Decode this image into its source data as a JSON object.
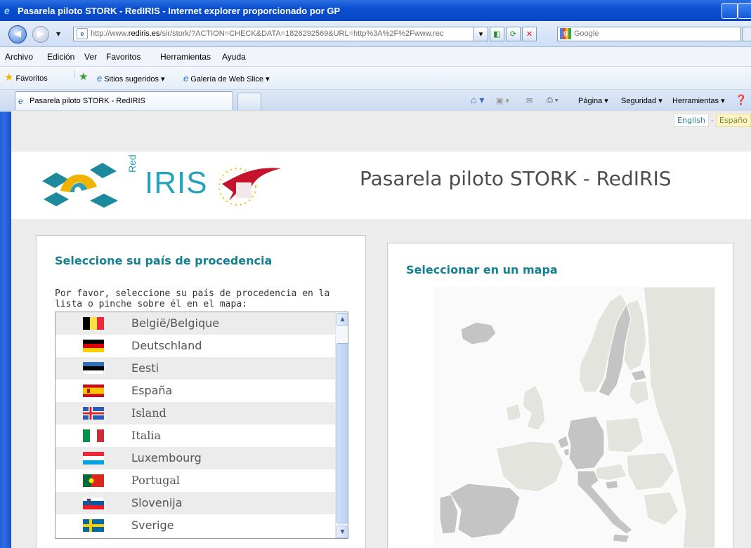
{
  "window": {
    "title": "Pasarela piloto STORK - RedIRIS - Internet explorer proporcionado por GP"
  },
  "address_bar": {
    "url_prefix": "http://www.",
    "url_domain": "rediris.es",
    "url_rest": "/sir/stork/?ACTION=CHECK&DATA=1826292569&URL=http%3A%2F%2Fwww.rec",
    "search_placeholder": "Google"
  },
  "menu": [
    "Archivo",
    "Edición",
    "Ver",
    "Favoritos",
    "Herramientas",
    "Ayuda"
  ],
  "favorites_bar": {
    "favorites_label": "Favoritos",
    "suggested_sites": "Sitios sugeridos ▾",
    "web_slice_gallery": "Galería de Web Slice ▾"
  },
  "tab": {
    "title": "Pasarela piloto STORK - RedIRIS"
  },
  "command_bar": {
    "page": "Página ▾",
    "security": "Seguridad ▾",
    "tools": "Herramientas ▾"
  },
  "language": {
    "english": "English",
    "separator": "-",
    "spanish": "Españo"
  },
  "header": {
    "red_label": "Red",
    "iris_label": "IRIS",
    "site_title": "Pasarela piloto STORK - RedIRIS"
  },
  "country_panel": {
    "title": "Seleccione su país de procedencia",
    "instructions": "Por favor, seleccione su país de procedencia en la lista o pinche sobre él en el mapa:",
    "countries": [
      {
        "name": "België/Belgique",
        "flag": "be"
      },
      {
        "name": "Deutschland",
        "flag": "de"
      },
      {
        "name": "Eesti",
        "flag": "ee"
      },
      {
        "name": "España",
        "flag": "es"
      },
      {
        "name": "Island",
        "flag": "is"
      },
      {
        "name": "Italia",
        "flag": "it"
      },
      {
        "name": "Luxembourg",
        "flag": "lu"
      },
      {
        "name": "Portugal",
        "flag": "pt"
      },
      {
        "name": "Slovenija",
        "flag": "si"
      },
      {
        "name": "Sverige",
        "flag": "se"
      }
    ]
  },
  "map_panel": {
    "title": "Seleccionar en un mapa"
  },
  "colors": {
    "accent_teal": "#15808f",
    "xp_blue": "#0a4fd1",
    "map_light": "#e4e4de",
    "map_selectable": "#c4c4c4"
  }
}
